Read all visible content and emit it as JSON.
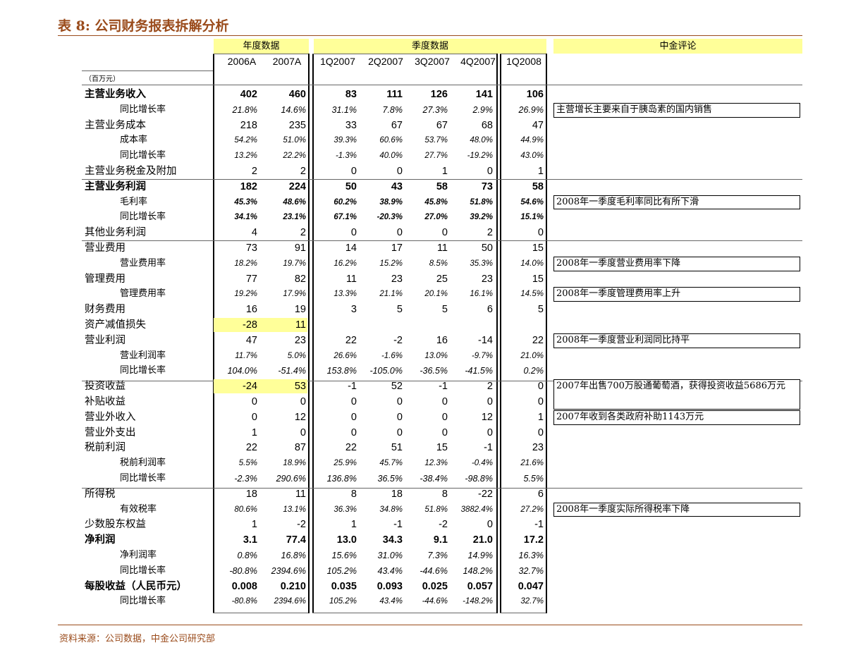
{
  "title": "表 8:  公司财务报表拆解分析",
  "footer": "资料来源：公司数据，中金公司研究部",
  "headers": {
    "annual_group": "年度数据",
    "quarterly_group": "季度数据",
    "comment_group": "中金评论",
    "unit": "（百万元）",
    "columns": [
      "2006A",
      "2007A",
      "1Q2007",
      "2Q2007",
      "3Q2007",
      "4Q2007",
      "1Q2008"
    ]
  },
  "colors": {
    "brand": "#9a4b1b",
    "highlight": "#ffff99"
  },
  "rows": [
    {
      "label": "主营业务收入",
      "level": 0,
      "bold": true,
      "style": "big",
      "values": [
        "402",
        "460",
        "83",
        "111",
        "126",
        "141",
        "106"
      ]
    },
    {
      "label": "同比增长率",
      "level": 1,
      "style": "small",
      "values": [
        "21.8%",
        "14.6%",
        "31.1%",
        "7.8%",
        "27.3%",
        "2.9%",
        "26.9%"
      ]
    },
    {
      "label": "主营业务成本",
      "level": 0,
      "style": "big",
      "values": [
        "218",
        "235",
        "33",
        "67",
        "67",
        "68",
        "47"
      ]
    },
    {
      "label": "成本率",
      "level": 1,
      "style": "tiny",
      "values": [
        "54.2%",
        "51.0%",
        "39.3%",
        "60.6%",
        "53.7%",
        "48.0%",
        "44.9%"
      ]
    },
    {
      "label": "同比增长率",
      "level": 1,
      "style": "tiny",
      "values": [
        "13.2%",
        "22.2%",
        "-1.3%",
        "40.0%",
        "27.7%",
        "-19.2%",
        "43.0%"
      ]
    },
    {
      "label": "主营业务税金及附加",
      "level": 0,
      "style": "big",
      "values": [
        "2",
        "2",
        "0",
        "0",
        "1",
        "0",
        "1"
      ]
    },
    {
      "label": "主营业务利润",
      "level": 0,
      "bold": true,
      "style": "big",
      "values": [
        "182",
        "224",
        "50",
        "43",
        "58",
        "73",
        "58"
      ]
    },
    {
      "label": "毛利率",
      "level": 1,
      "bold": true,
      "style": "tiny",
      "values": [
        "45.3%",
        "48.6%",
        "60.2%",
        "38.9%",
        "45.8%",
        "51.8%",
        "54.6%"
      ]
    },
    {
      "label": "同比增长率",
      "level": 1,
      "bold": true,
      "style": "tiny",
      "values": [
        "34.1%",
        "23.1%",
        "67.1%",
        "-20.3%",
        "27.0%",
        "39.2%",
        "15.1%"
      ]
    },
    {
      "label": "其他业务利润",
      "level": 0,
      "style": "big",
      "values": [
        "4",
        "2",
        "0",
        "0",
        "0",
        "2",
        "0"
      ]
    },
    {
      "label": "营业费用",
      "level": 0,
      "style": "big",
      "values": [
        "73",
        "91",
        "14",
        "17",
        "11",
        "50",
        "15"
      ]
    },
    {
      "label": "营业费用率",
      "level": 1,
      "style": "tiny",
      "values": [
        "18.2%",
        "19.7%",
        "16.2%",
        "15.2%",
        "8.5%",
        "35.3%",
        "14.0%"
      ]
    },
    {
      "label": "管理费用",
      "level": 0,
      "style": "big",
      "values": [
        "77",
        "82",
        "11",
        "23",
        "25",
        "23",
        "15"
      ]
    },
    {
      "label": "管理费用率",
      "level": 1,
      "style": "tiny",
      "values": [
        "19.2%",
        "17.9%",
        "13.3%",
        "21.1%",
        "20.1%",
        "16.1%",
        "14.5%"
      ]
    },
    {
      "label": "财务费用",
      "level": 0,
      "style": "big",
      "values": [
        "16",
        "19",
        "3",
        "5",
        "5",
        "6",
        "5"
      ]
    },
    {
      "label": "资产减值损失",
      "level": 0,
      "style": "big",
      "highlight": true,
      "values": [
        "-28",
        "11",
        "",
        "",
        "",
        "",
        ""
      ]
    },
    {
      "label": "营业利润",
      "level": 0,
      "style": "big",
      "values": [
        "47",
        "23",
        "22",
        "-2",
        "16",
        "-14",
        "22"
      ]
    },
    {
      "label": "营业利润率",
      "level": 1,
      "style": "tiny",
      "values": [
        "11.7%",
        "5.0%",
        "26.6%",
        "-1.6%",
        "13.0%",
        "-9.7%",
        "21.0%"
      ]
    },
    {
      "label": "同比增长率",
      "level": 1,
      "style": "small",
      "values": [
        "104.0%",
        "-51.4%",
        "153.8%",
        "-105.0%",
        "-36.5%",
        "-41.5%",
        "0.2%"
      ]
    },
    {
      "label": "投资收益",
      "level": 0,
      "style": "big",
      "highlight": true,
      "values": [
        "-24",
        "53",
        "-1",
        "52",
        "-1",
        "2",
        "0"
      ]
    },
    {
      "label": "补贴收益",
      "level": 0,
      "style": "big",
      "values": [
        "0",
        "0",
        "0",
        "0",
        "0",
        "0",
        "0"
      ]
    },
    {
      "label": "营业外收入",
      "level": 0,
      "style": "big",
      "values": [
        "0",
        "12",
        "0",
        "0",
        "0",
        "12",
        "1"
      ]
    },
    {
      "label": "营业外支出",
      "level": 0,
      "style": "big",
      "values": [
        "1",
        "0",
        "0",
        "0",
        "0",
        "0",
        "0"
      ]
    },
    {
      "label": "税前利润",
      "level": 0,
      "style": "big",
      "values": [
        "22",
        "87",
        "22",
        "51",
        "15",
        "-1",
        "23"
      ]
    },
    {
      "label": "税前利润率",
      "level": 1,
      "style": "tiny",
      "values": [
        "5.5%",
        "18.9%",
        "25.9%",
        "45.7%",
        "12.3%",
        "-0.4%",
        "21.6%"
      ]
    },
    {
      "label": "同比增长率",
      "level": 1,
      "style": "small",
      "values": [
        "-2.3%",
        "290.6%",
        "136.8%",
        "36.5%",
        "-38.4%",
        "-98.8%",
        "5.5%"
      ]
    },
    {
      "label": "所得税",
      "level": 0,
      "style": "big",
      "values": [
        "18",
        "11",
        "8",
        "18",
        "8",
        "-22",
        "6"
      ]
    },
    {
      "label": "有效税率",
      "level": 1,
      "style": "tiny",
      "values": [
        "80.6%",
        "13.1%",
        "36.3%",
        "34.8%",
        "51.8%",
        "3882.4%",
        "27.2%"
      ]
    },
    {
      "label": "少数股东权益",
      "level": 0,
      "style": "big",
      "values": [
        "1",
        "-2",
        "1",
        "-1",
        "-2",
        "0",
        "-1"
      ]
    },
    {
      "label": "净利润",
      "level": 0,
      "bold": true,
      "style": "big",
      "values": [
        "3.1",
        "77.4",
        "13.0",
        "34.3",
        "9.1",
        "21.0",
        "17.2"
      ]
    },
    {
      "label": "净利润率",
      "level": 1,
      "style": "small",
      "values": [
        "0.8%",
        "16.8%",
        "15.6%",
        "31.0%",
        "7.3%",
        "14.9%",
        "16.3%"
      ]
    },
    {
      "label": "同比增长率",
      "level": 1,
      "style": "small",
      "values": [
        "-80.8%",
        "2394.6%",
        "105.2%",
        "43.4%",
        "-44.6%",
        "148.2%",
        "32.7%"
      ]
    },
    {
      "label": "每股收益（人民币元）",
      "level": 0,
      "bold": true,
      "style": "big",
      "values": [
        "0.008",
        "0.210",
        "0.035",
        "0.093",
        "0.025",
        "0.057",
        "0.047"
      ]
    },
    {
      "label": "同比增长率",
      "level": 1,
      "style": "tiny",
      "values": [
        "-80.8%",
        "2394.6%",
        "105.2%",
        "43.4%",
        "-44.6%",
        "-148.2%",
        "32.7%"
      ]
    }
  ],
  "comments": [
    {
      "row": 1,
      "span": 1,
      "text": "主营增长主要来自于胰岛素的国内销售"
    },
    {
      "row": 7,
      "span": 1,
      "text": "2008年一季度毛利率同比有所下滑"
    },
    {
      "row": 11,
      "span": 1,
      "text": "2008年一季度营业费用率下降"
    },
    {
      "row": 13,
      "span": 1,
      "text": "2008年一季度管理费用率上升"
    },
    {
      "row": 16,
      "span": 1,
      "text": "2008年一季度营业利润同比持平"
    },
    {
      "row": 19,
      "span": 2,
      "text": "2007年出售700万股通葡萄酒，获得投资收益5686万元"
    },
    {
      "row": 21,
      "span": 1,
      "text": "2007年收到各类政府补助1143万元"
    },
    {
      "row": 27,
      "span": 1,
      "text": "2008年一季度实际所得税率下降"
    }
  ]
}
